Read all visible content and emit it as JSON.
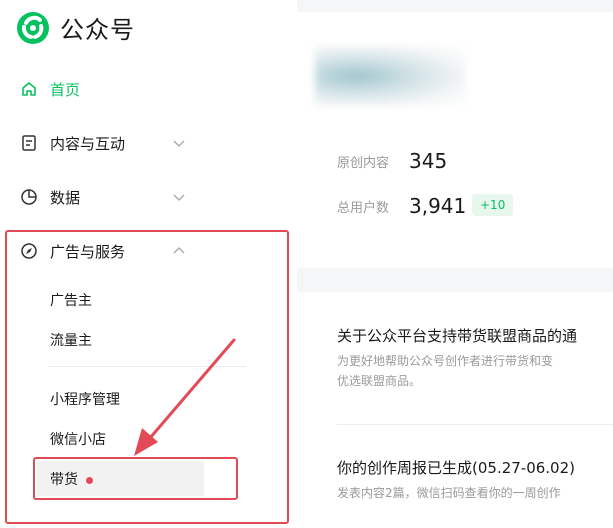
{
  "app": {
    "title": "公众号"
  },
  "sidebar": {
    "home": "首页",
    "content": "内容与互动",
    "data": "数据",
    "ads": "广告与服务",
    "ads_items": [
      "广告主",
      "流量主",
      "小程序管理",
      "微信小店",
      "带货"
    ]
  },
  "colors": {
    "accent": "#07c160",
    "highlight": "#e24a56"
  },
  "icons": [
    "home-icon",
    "document-icon",
    "pie-chart-icon",
    "compass-icon",
    "chevron-down-icon",
    "chevron-up-icon"
  ],
  "stats": {
    "original_label": "原创内容",
    "original_value": "345",
    "users_label": "总用户数",
    "users_value": "3,941",
    "users_delta": "+10"
  },
  "notices": [
    {
      "title": "关于公众平台支持带货联盟商品的通",
      "desc_line1": "为更好地帮助公众号创作者进行带货和变",
      "desc_line2": "优选联盟商品。"
    },
    {
      "title": "你的创作周报已生成(05.27-06.02)",
      "desc_line1": "发表内容2篇，微信扫码查看你的一周创作"
    }
  ]
}
